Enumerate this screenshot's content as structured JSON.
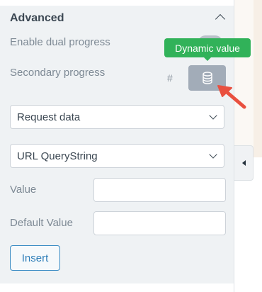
{
  "section": {
    "title": "Advanced"
  },
  "dual_progress": {
    "label": "Enable dual progress",
    "enabled": false
  },
  "secondary_progress": {
    "label": "Secondary progress",
    "hash_symbol": "#"
  },
  "tooltip": {
    "text": "Dynamic value"
  },
  "source_select": {
    "value": "Request data"
  },
  "type_select": {
    "value": "URL QueryString"
  },
  "value_field": {
    "label": "Value",
    "value": ""
  },
  "default_field": {
    "label": "Default Value",
    "value": ""
  },
  "insert_button": {
    "label": "Insert"
  },
  "colors": {
    "tooltip_green": "#31b259",
    "arrow_red": "#e9503f",
    "button_blue": "#3b8cc4",
    "panel_bg": "#eff2f4"
  },
  "icons": [
    "chevron-up-icon",
    "database-icon",
    "chevron-down-icon",
    "collapse-left-icon"
  ]
}
